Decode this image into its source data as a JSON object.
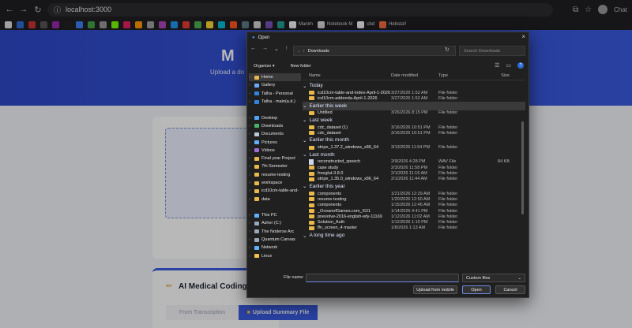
{
  "browser": {
    "url": "localhost:3000",
    "profile": "Chat",
    "bookmarks": [
      {
        "label": "",
        "color": "#e0e0e0"
      },
      {
        "label": "",
        "color": "#2d6bd6"
      },
      {
        "label": "",
        "color": "#c33"
      },
      {
        "label": "",
        "color": "#555"
      },
      {
        "label": "",
        "color": "#9c27b0"
      },
      {
        "label": "",
        "color": "#222"
      },
      {
        "label": "",
        "color": "#3b82f6"
      },
      {
        "label": "",
        "color": "#43a047"
      },
      {
        "label": "",
        "color": "#999"
      },
      {
        "label": "",
        "color": "#76ff03"
      },
      {
        "label": "",
        "color": "#e91e63"
      },
      {
        "label": "",
        "color": "#ff9800"
      },
      {
        "label": "",
        "color": "#9e9e9e"
      },
      {
        "label": "",
        "color": "#ab47bc"
      },
      {
        "label": "",
        "color": "#2196f3"
      },
      {
        "label": "",
        "color": "#e53935"
      },
      {
        "label": "",
        "color": "#4caf50"
      },
      {
        "label": "",
        "color": "#fdd835"
      },
      {
        "label": "",
        "color": "#00bcd4"
      },
      {
        "label": "",
        "color": "#ff5722"
      },
      {
        "label": "",
        "color": "#607d8b"
      },
      {
        "label": "",
        "color": "#ddd"
      },
      {
        "label": "",
        "color": "#7e57c2"
      },
      {
        "label": "",
        "color": "#26a69a"
      },
      {
        "label": "Manim",
        "color": "#ffffff"
      },
      {
        "label": "Notebook M",
        "color": "#e0e0e0"
      },
      {
        "label": "cbd",
        "color": "#ffffff"
      },
      {
        "label": "Hebsta!!",
        "color": "#ff7043"
      }
    ]
  },
  "app": {
    "title": "M",
    "subtitle": "Upload a do",
    "section_icon": "✏",
    "section_title": "AI Medical Coding",
    "tab_transcription": "From Transcription",
    "tab_upload": "Upload Summary File"
  },
  "dialog": {
    "title": "Open",
    "path": "Downloads",
    "search_placeholder": "Search Downloads",
    "organize": "Organize ▾",
    "new_folder": "New folder",
    "columns": {
      "name": "Name",
      "date": "Date modified",
      "type": "Type",
      "size": "Size"
    },
    "sidebar": [
      {
        "label": "Home",
        "color": "#e8b84a",
        "selected": true
      },
      {
        "label": "Gallery",
        "color": "#6aa9ff"
      },
      {
        "label": "Talha - Personal",
        "color": "#2f86e0"
      },
      {
        "label": "Talha - main(a.d.)",
        "color": "#2f86e0"
      },
      {
        "label": "",
        "color": "transparent"
      },
      {
        "label": "Desktop",
        "color": "#4fa3ff"
      },
      {
        "label": "Downloads",
        "color": "#46b36a"
      },
      {
        "label": "Documents",
        "color": "#b9c7db"
      },
      {
        "label": "Pictures",
        "color": "#5fb0ff"
      },
      {
        "label": "Videos",
        "color": "#a36bd6"
      },
      {
        "label": "Final year Project",
        "color": "#e8b84a"
      },
      {
        "label": "7th Semester",
        "color": "#e8b84a"
      },
      {
        "label": "resume-testing",
        "color": "#e8b84a"
      },
      {
        "label": "workspace",
        "color": "#e8b84a"
      },
      {
        "label": "icd10cm-table-and-",
        "color": "#e8b84a"
      },
      {
        "label": "data",
        "color": "#e8b84a"
      },
      {
        "label": "",
        "color": "transparent"
      },
      {
        "label": "This PC",
        "color": "#5fb0ff"
      },
      {
        "label": "Asher (C:)",
        "color": "#9aa7b8"
      },
      {
        "label": "The Noderse Arc",
        "color": "#9aa7b8"
      },
      {
        "label": "Quantum Canvas",
        "color": "#9aa7b8"
      },
      {
        "label": "Network",
        "color": "#5fb0ff"
      },
      {
        "label": "Linux",
        "color": "#f0c04a"
      }
    ],
    "groups": [
      {
        "label": "Today",
        "hl": false,
        "items": [
          {
            "name": "icd10cm-table-and-index-April-1-2026",
            "date": "3/27/2026 1:52 AM",
            "type": "File folder",
            "size": "",
            "kind": "folder"
          },
          {
            "name": "icd10cm-addenda-April-1-2026",
            "date": "3/27/2026 1:52 AM",
            "type": "File folder",
            "size": "",
            "kind": "folder"
          }
        ]
      },
      {
        "label": "Earlier this week",
        "hl": true,
        "items": [
          {
            "name": "Untitled",
            "date": "3/26/2026 8:15 PM",
            "type": "File folder",
            "size": "",
            "kind": "folder"
          }
        ]
      },
      {
        "label": "Last week",
        "hl": false,
        "items": [
          {
            "name": "cdc_dataset (1)",
            "date": "3/16/2026 10:51 PM",
            "type": "File folder",
            "size": "",
            "kind": "folder"
          },
          {
            "name": "cdc_dataset",
            "date": "3/16/2026 10:51 PM",
            "type": "File folder",
            "size": "",
            "kind": "folder"
          }
        ]
      },
      {
        "label": "Earlier this month",
        "hl": false,
        "items": [
          {
            "name": "stripe_1.37.2_windows_x86_64",
            "date": "3/13/2026 11:54 PM",
            "type": "File folder",
            "size": "",
            "kind": "folder"
          }
        ]
      },
      {
        "label": "Last month",
        "hl": false,
        "items": [
          {
            "name": "reconstructed_speech",
            "date": "2/9/2026 4:28 PM",
            "type": "WAV File",
            "size": "84 KB",
            "kind": "file"
          },
          {
            "name": "case study",
            "date": "2/3/2026 11:58 PM",
            "type": "File folder",
            "size": "",
            "kind": "folder"
          },
          {
            "name": "freeglut-3.8.0",
            "date": "2/1/2026 11:16 AM",
            "type": "File folder",
            "size": "",
            "kind": "folder"
          },
          {
            "name": "stripe_1.35.0_windows_x86_64",
            "date": "2/1/2026 11:44 AM",
            "type": "File folder",
            "size": "",
            "kind": "folder"
          }
        ]
      },
      {
        "label": "Earlier this year",
        "hl": false,
        "items": [
          {
            "name": "components",
            "date": "1/21/2026 12:29 AM",
            "type": "File folder",
            "size": "",
            "kind": "folder"
          },
          {
            "name": "resume-testing",
            "date": "1/20/2026 12:50 AM",
            "type": "File folder",
            "size": "",
            "kind": "folder"
          },
          {
            "name": "components",
            "date": "1/15/2026 12:46 AM",
            "type": "File folder",
            "size": "",
            "kind": "folder"
          },
          {
            "name": "_OceanofGames.com_IGI1",
            "date": "1/14/2026 4:41 PM",
            "type": "File folder",
            "size": "",
            "kind": "folder"
          },
          {
            "name": "pnevolve-2016-english-wfy-11169",
            "date": "1/12/2026 11:02 AM",
            "type": "File folder",
            "size": "",
            "kind": "folder"
          },
          {
            "name": "Solution_Auth",
            "date": "1/12/2026 1:10 PM",
            "type": "File folder",
            "size": "",
            "kind": "folder"
          },
          {
            "name": "ffn_screen_4 master",
            "date": "1/8/2026 1:13 AM",
            "type": "File folder",
            "size": "",
            "kind": "folder"
          }
        ]
      },
      {
        "label": "A long time ago",
        "hl": false,
        "items": []
      }
    ],
    "file_name_label": "File name:",
    "file_name_value": "",
    "file_type": "Custom files",
    "upload_mobile": "Upload from mobile",
    "open": "Open",
    "cancel": "Cancel"
  }
}
